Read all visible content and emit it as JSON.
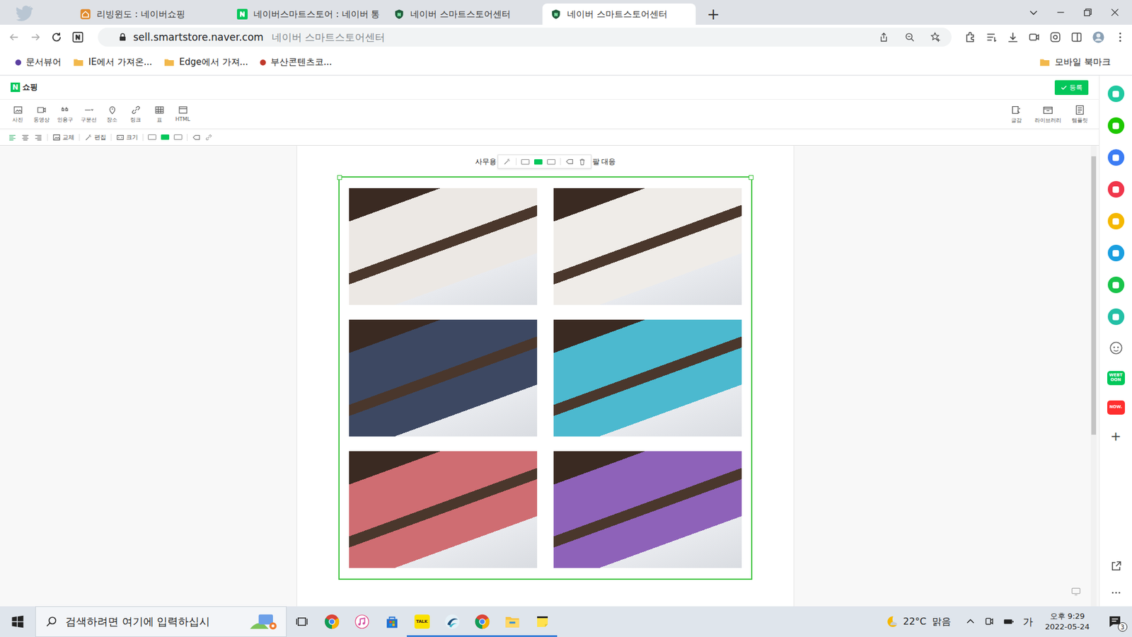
{
  "browser": {
    "tabs": [
      {
        "label": "리빙윈도 : 네이버쇼핑",
        "kind": "house",
        "selected": false
      },
      {
        "label": "네이버스마트스토어 : 네이버 통",
        "kind": "naver",
        "selected": false
      },
      {
        "label": "네이버 스마트스토어센터",
        "kind": "shield",
        "selected": false
      },
      {
        "label": "네이버 스마트스토어센터",
        "kind": "shield",
        "selected": true
      }
    ],
    "new_tab": "+",
    "address": {
      "url": "sell.smartstore.naver.com",
      "title": "네이버 스마트스토어센터"
    },
    "bookmarks": [
      {
        "label": "문서뷰어",
        "kind": "dot",
        "color": "#5b3fa0"
      },
      {
        "label": "IE에서 가져온...",
        "kind": "folder",
        "color": "#f2b84b"
      },
      {
        "label": "Edge에서 가져...",
        "kind": "folder",
        "color": "#f2b84b"
      },
      {
        "label": "부산콘텐츠코...",
        "kind": "dot",
        "color": "#c0392b"
      }
    ],
    "mobile_bookmarks": "모바일 북마크"
  },
  "editor": {
    "logo": "N",
    "service": "쇼핑",
    "register": "등록",
    "tools": [
      {
        "label": "사진"
      },
      {
        "label": "동영상"
      },
      {
        "label": "인용구"
      },
      {
        "label": "구분선"
      },
      {
        "label": "장소"
      },
      {
        "label": "링크"
      },
      {
        "label": "표"
      },
      {
        "label": "HTML"
      }
    ],
    "right_tools": [
      {
        "label": "글감"
      },
      {
        "label": "라이브러리"
      },
      {
        "label": "템플릿"
      }
    ],
    "format_tools": [
      {
        "label": "교체"
      },
      {
        "label": "편집"
      },
      {
        "label": "크기"
      }
    ],
    "layouts": [
      {
        "selected": false
      },
      {
        "selected": true
      },
      {
        "selected": false
      }
    ],
    "caption_left": "사무용",
    "caption_right": "팔 대응",
    "photos": [
      {
        "color": "#ece8e4"
      },
      {
        "color": "#efece8"
      },
      {
        "color": "#3d4862"
      },
      {
        "color": "#4cb9cf"
      },
      {
        "color": "#cf6d72"
      },
      {
        "color": "#8e62b9"
      }
    ]
  },
  "sidebar": {
    "apps": [
      {
        "kind": "icon",
        "color": "#20c9a0"
      },
      {
        "kind": "icon",
        "color": "#1ec800"
      },
      {
        "kind": "icon",
        "color": "#3b7cf4"
      },
      {
        "kind": "icon",
        "color": "#f0364b"
      },
      {
        "kind": "icon",
        "color": "#f5b800"
      },
      {
        "kind": "icon",
        "color": "#1a9fe0"
      },
      {
        "kind": "icon",
        "color": "#19c44a"
      },
      {
        "kind": "icon",
        "color": "#23c0a6"
      },
      {
        "kind": "face",
        "color": "#666666"
      },
      {
        "kind": "logo",
        "label": "WEBTOON",
        "color": "#00c85a"
      },
      {
        "kind": "logo",
        "label": "NOW.",
        "color": "#ff2e2e"
      },
      {
        "kind": "add",
        "label": "+",
        "color": "#444444"
      }
    ]
  },
  "taskbar": {
    "search": "검색하려면 여기에 입력하십시",
    "apps": [
      {
        "kind": "taskview",
        "running": false
      },
      {
        "kind": "chrome",
        "running": false
      },
      {
        "kind": "music",
        "running": false
      },
      {
        "kind": "store",
        "running": false
      },
      {
        "kind": "kakao",
        "label": "TALK",
        "running": true
      },
      {
        "kind": "swirl",
        "running": true
      },
      {
        "kind": "chrome",
        "running": true
      },
      {
        "kind": "folder",
        "running": true
      },
      {
        "kind": "notes",
        "running": true
      }
    ],
    "weather": "22°C  맑음",
    "ime": "가",
    "time": "오후 9:29",
    "date": "2022-05-24",
    "notifications": "3"
  }
}
